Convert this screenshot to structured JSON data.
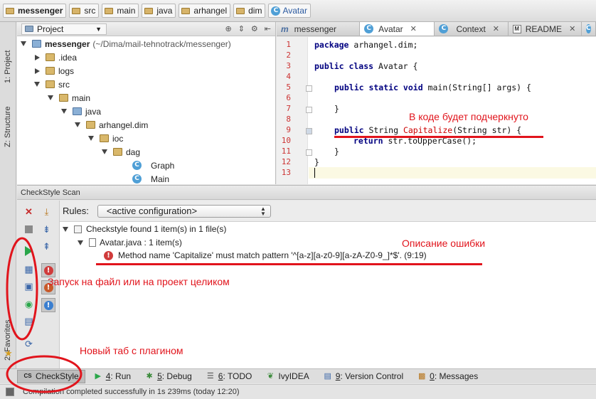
{
  "breadcrumb": [
    "messenger",
    "src",
    "main",
    "java",
    "arhangel",
    "dim",
    "Avatar"
  ],
  "left_strip": {
    "project_tab": "1: Project",
    "structure_tab": "Z: Structure",
    "favorites_tab": "2: Favorites"
  },
  "project_panel": {
    "selector": "Project",
    "tree": [
      {
        "label": "messenger",
        "path": "(~/Dima/mail-tehnotrack/messenger)",
        "kind": "module",
        "expanded": true
      },
      {
        "label": ".idea",
        "kind": "folder",
        "expanded": false
      },
      {
        "label": "logs",
        "kind": "folder",
        "expanded": false
      },
      {
        "label": "src",
        "kind": "folder",
        "expanded": true
      },
      {
        "label": "main",
        "kind": "folder",
        "expanded": true
      },
      {
        "label": "java",
        "kind": "source-folder",
        "expanded": true
      },
      {
        "label": "arhangel.dim",
        "kind": "package",
        "expanded": true
      },
      {
        "label": "ioc",
        "kind": "package",
        "expanded": true
      },
      {
        "label": "dag",
        "kind": "package",
        "expanded": true
      },
      {
        "label": "Graph",
        "kind": "class"
      },
      {
        "label": "Main",
        "kind": "class"
      }
    ]
  },
  "editor_tabs": [
    {
      "label": "messenger",
      "active": false
    },
    {
      "label": "Avatar",
      "active": true
    },
    {
      "label": "Context",
      "active": false
    },
    {
      "label": "README",
      "active": false
    }
  ],
  "code": {
    "line_numbers": [
      "1",
      "2",
      "3",
      "4",
      "5",
      "6",
      "7",
      "8",
      "9",
      "10",
      "11",
      "12",
      "13"
    ],
    "line1_kw": "package",
    "line1_rest": " arhangel.dim;",
    "line3_kw": "public class",
    "line3_rest": " Avatar {",
    "line5_kw": "public static void",
    "line5_rest": " main(String[] args) {",
    "line7": "}",
    "line9_kw": "public",
    "line9_type": " String ",
    "line9_err": "Capitalize",
    "line9_rest": "(String str) {",
    "line10_kw": "return",
    "line10_rest": " str.toUpperCase();",
    "line11": "}",
    "line12": "}"
  },
  "checkstyle": {
    "panel_title": "CheckStyle Scan",
    "rules_label": "Rules:",
    "rules_value": "<active configuration>",
    "summary": "Checkstyle found 1 item(s) in 1 file(s)",
    "file_row": "Avatar.java : 1 item(s)",
    "message": "Method name 'Capitalize' must match pattern '^[a-z][a-z0-9][a-zA-Z0-9_]*$'. (9:19)"
  },
  "tool_windows": [
    {
      "label": "CheckStyle",
      "active": true
    },
    {
      "num": "4",
      "label": ": Run"
    },
    {
      "num": "5",
      "label": ": Debug"
    },
    {
      "num": "6",
      "label": ": TODO"
    },
    {
      "label": "IvyIDEA"
    },
    {
      "num": "9",
      "label": ": Version Control"
    },
    {
      "num": "0",
      "label": ": Messages"
    }
  ],
  "status_text": "Compilation completed successfully in 1s 239ms (today 12:20)",
  "annotations": {
    "underline_note": "В коде будет подчеркнуто",
    "error_note": "Описание ошибки",
    "run_note": "Запуск на файл или на проект целиком",
    "tab_note": "Новый таб с плагином"
  },
  "colors": {
    "annotation": "#e1141c",
    "keyword": "#000080",
    "error_text": "#cc0000"
  }
}
